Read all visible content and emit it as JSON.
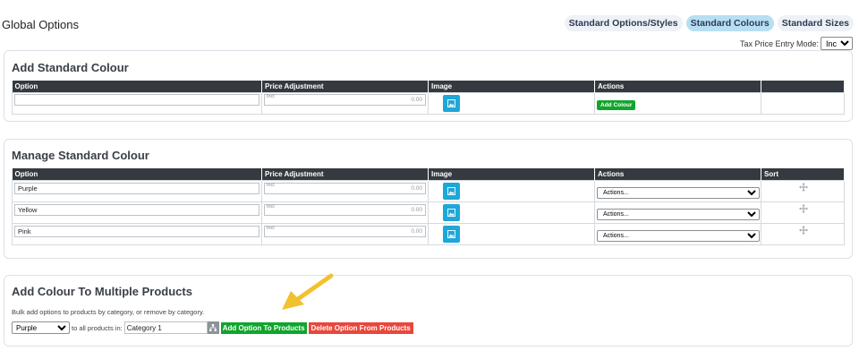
{
  "page": {
    "title": "Global Options"
  },
  "tabs": [
    {
      "label": "Standard Options/Styles",
      "active": false
    },
    {
      "label": "Standard Colours",
      "active": true
    },
    {
      "label": "Standard Sizes",
      "active": false
    }
  ],
  "tax": {
    "label": "Tax Price Entry Mode:",
    "value": "Incl"
  },
  "add_panel": {
    "title": "Add Standard Colour",
    "columns": [
      "Option",
      "Price Adjustment",
      "Image",
      "Actions",
      ""
    ],
    "option_value": "",
    "price_prefix": "Incl",
    "price_value": "0.00",
    "button_label": "Add Colour"
  },
  "manage_panel": {
    "title": "Manage Standard Colour",
    "columns": [
      "Option",
      "Price Adjustment",
      "Image",
      "Actions",
      "Sort"
    ],
    "rows": [
      {
        "option": "Purple",
        "price_prefix": "Incl",
        "price": "0.00",
        "action": "Actions..."
      },
      {
        "option": "Yellow",
        "price_prefix": "Incl",
        "price": "0.00",
        "action": "Actions..."
      },
      {
        "option": "Pink",
        "price_prefix": "Incl",
        "price": "0.00",
        "action": "Actions..."
      }
    ]
  },
  "bulk_panel": {
    "title": "Add Colour To Multiple Products",
    "description": "Bulk add options to products by category, or remove by category.",
    "colour_select": "Purple",
    "connector": "to all products in:",
    "category_value": "Category 1",
    "add_button": "Add Option To Products",
    "delete_button": "Delete Option From Products"
  },
  "colors": {
    "accent_green": "#10a52c",
    "accent_red": "#e8473b",
    "image_button": "#1ea7d8",
    "header_dark": "#343a40",
    "tab_active": "#b7dff3",
    "arrow": "#f2c12e"
  },
  "icons": [
    "image-icon",
    "move-arrows-icon",
    "sitemap-icon",
    "yellow-arrow"
  ]
}
